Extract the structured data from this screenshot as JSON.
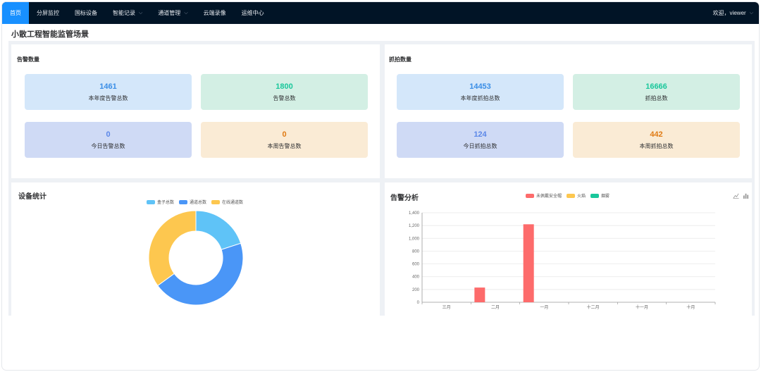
{
  "nav": {
    "items": [
      {
        "label": "首页",
        "active": true,
        "dropdown": false
      },
      {
        "label": "分屏监控",
        "active": false,
        "dropdown": false
      },
      {
        "label": "国标设备",
        "active": false,
        "dropdown": false
      },
      {
        "label": "智能记录",
        "active": false,
        "dropdown": true
      },
      {
        "label": "通道管理",
        "active": false,
        "dropdown": true
      },
      {
        "label": "云端录像",
        "active": false,
        "dropdown": false
      },
      {
        "label": "运维中心",
        "active": false,
        "dropdown": false
      }
    ],
    "welcome": "欢迎，viewer"
  },
  "page": {
    "title": "小散工程智能监管场景"
  },
  "alarm_count": {
    "title": "告警数量",
    "cards": [
      {
        "value": "1461",
        "label": "本年度告警总数",
        "style": "blue"
      },
      {
        "value": "1800",
        "label": "告警总数",
        "style": "green"
      },
      {
        "value": "0",
        "label": "今日告警总数",
        "style": "indigo"
      },
      {
        "value": "0",
        "label": "本周告警总数",
        "style": "orange"
      }
    ]
  },
  "capture_count": {
    "title": "抓拍数量",
    "cards": [
      {
        "value": "14453",
        "label": "本年度抓拍总数",
        "style": "blue"
      },
      {
        "value": "16666",
        "label": "抓拍总数",
        "style": "green"
      },
      {
        "value": "124",
        "label": "今日抓拍总数",
        "style": "indigo"
      },
      {
        "value": "442",
        "label": "本周抓拍总数",
        "style": "orange"
      }
    ]
  },
  "device_stats": {
    "title": "设备统计",
    "chart_data": {
      "type": "pie",
      "variant": "donut",
      "legend_position": "top-center",
      "slices": [
        {
          "name": "盒子总数",
          "value": 20,
          "color": "#5fc3f7"
        },
        {
          "name": "通道总数",
          "value": 45,
          "color": "#4a96f7"
        },
        {
          "name": "在线通道数",
          "value": 35,
          "color": "#fdc74f"
        }
      ]
    }
  },
  "alarm_analysis": {
    "title": "告警分析",
    "toolbox": {
      "line_icon": "line-chart-icon",
      "bar_icon": "bar-chart-icon"
    },
    "chart_data": {
      "type": "bar",
      "legend_position": "top-center",
      "categories": [
        "三月",
        "二月",
        "一月",
        "十二月",
        "十一月",
        "十月"
      ],
      "series": [
        {
          "name": "未佩戴安全帽",
          "color": "#fd6b6b",
          "values": [
            0,
            230,
            1220,
            0,
            0,
            0
          ]
        },
        {
          "name": "火焰",
          "color": "#fdc74f",
          "values": [
            0,
            0,
            0,
            0,
            0,
            0
          ]
        },
        {
          "name": "烟雾",
          "color": "#19c79b",
          "values": [
            0,
            0,
            0,
            0,
            0,
            0
          ]
        }
      ],
      "ylim": [
        0,
        1400
      ],
      "yticks": [
        0,
        200,
        400,
        600,
        800,
        1000,
        1200,
        1400
      ],
      "ytick_labels": [
        "0",
        "200",
        "400",
        "600",
        "800",
        "1,000",
        "1,200",
        "1,400"
      ],
      "grid": true
    }
  }
}
